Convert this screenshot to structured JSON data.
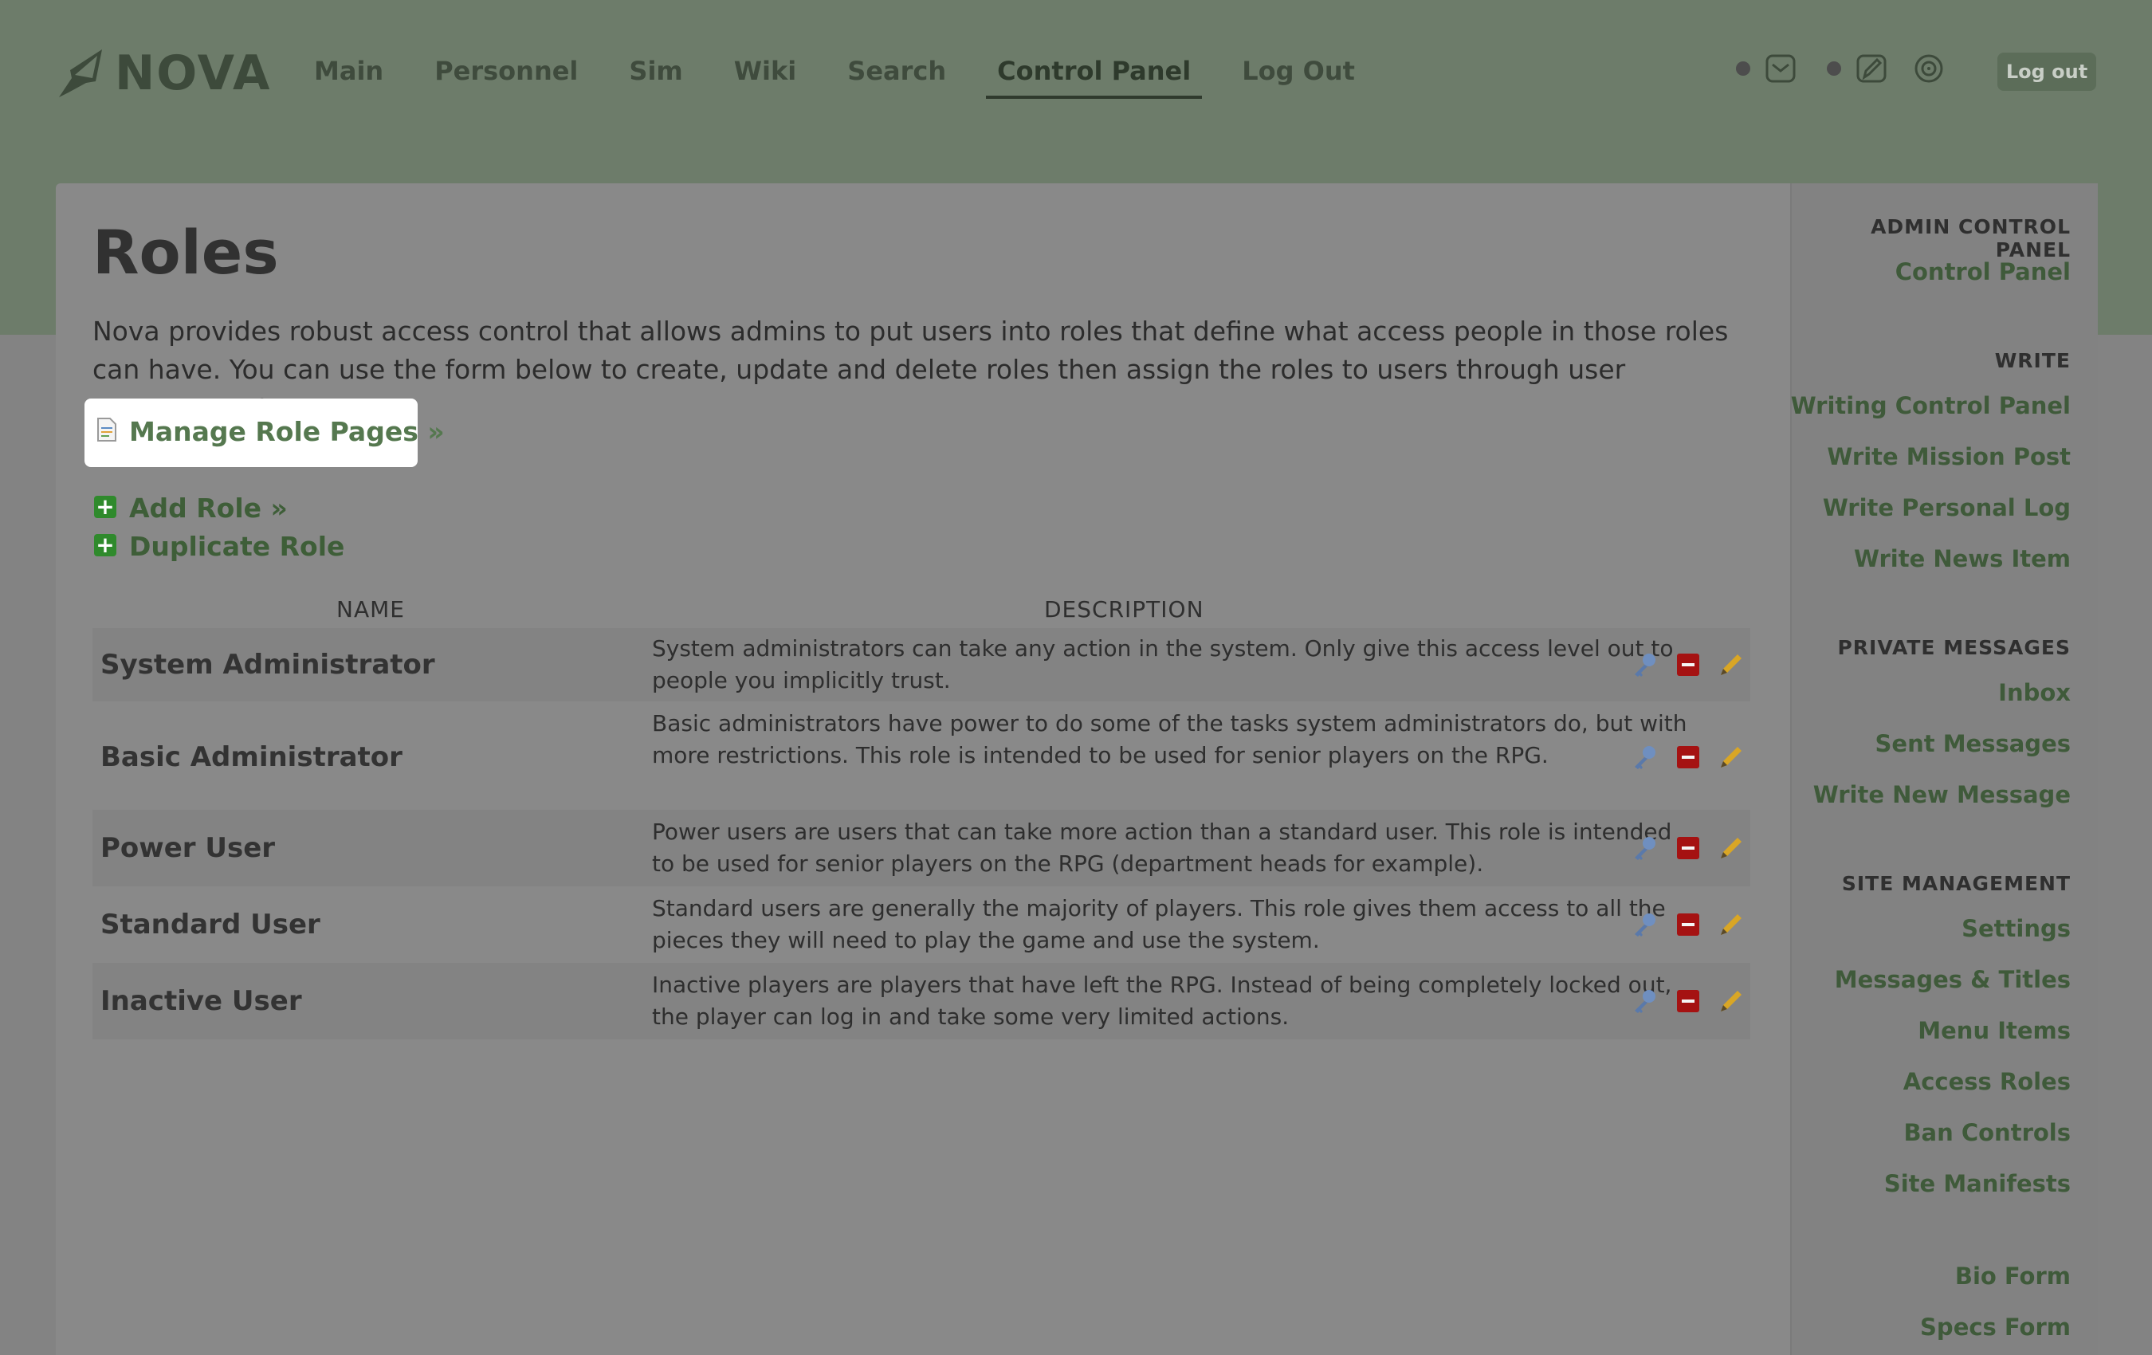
{
  "brand": {
    "name": "NOVA"
  },
  "nav": {
    "items": [
      {
        "label": "Main"
      },
      {
        "label": "Personnel"
      },
      {
        "label": "Sim"
      },
      {
        "label": "Wiki"
      },
      {
        "label": "Search"
      },
      {
        "label": "Control Panel"
      },
      {
        "label": "Log Out"
      }
    ],
    "active": "Control Panel",
    "logout_button": "Log out",
    "icons": [
      "inbox-icon",
      "write-icon",
      "settings-icon"
    ]
  },
  "main": {
    "title": "Roles",
    "intro": "Nova provides robust access control that allows admins to put users into roles that define what access people in those roles can have. You can use the form below to create, update and delete roles then assign the roles to users through user management.",
    "manage_link": "Manage Role Pages »",
    "add_role": "Add Role »",
    "duplicate_role": "Duplicate Role",
    "table": {
      "headers": {
        "name": "NAME",
        "description": "DESCRIPTION"
      },
      "rows": [
        {
          "name": "System Administrator",
          "description": "System administrators can take any action in the system. Only give this access level out to people you implicitly trust."
        },
        {
          "name": "Basic Administrator",
          "description": "Basic administrators have power to do some of the tasks system administrators do, but with more restrictions. This role is intended to be used for senior players on the RPG."
        },
        {
          "name": "Power User",
          "description": "Power users are users that can take more action than a standard user. This role is intended to be used for senior players on the RPG (department heads for example)."
        },
        {
          "name": "Standard User",
          "description": "Standard users are generally the majority of players. This role gives them access to all the pieces they will need to play the game and use the system."
        },
        {
          "name": "Inactive User",
          "description": "Inactive players are players that have left the RPG. Instead of being completely locked out, the player can log in and take some very limited actions."
        }
      ]
    }
  },
  "sidebar": {
    "sections": [
      {
        "heading": "ADMIN CONTROL PANEL",
        "links": [
          "Control Panel"
        ]
      },
      {
        "heading": "WRITE",
        "links": [
          "Writing Control Panel",
          "Write Mission Post",
          "Write Personal Log",
          "Write News Item"
        ]
      },
      {
        "heading": "PRIVATE MESSAGES",
        "links": [
          "Inbox",
          "Sent Messages",
          "Write New Message"
        ]
      },
      {
        "heading": "SITE MANAGEMENT",
        "links": [
          "Settings",
          "Messages & Titles",
          "Menu Items",
          "Access Roles",
          "Ban Controls",
          "Site Manifests"
        ]
      },
      {
        "heading": "",
        "links": [
          "Bio Form",
          "Specs Form"
        ]
      }
    ]
  },
  "colors": {
    "header": "#6d7c6a",
    "overlay_gray": "#898989",
    "accent_green": "#55784f",
    "delete_red": "#a51212"
  }
}
